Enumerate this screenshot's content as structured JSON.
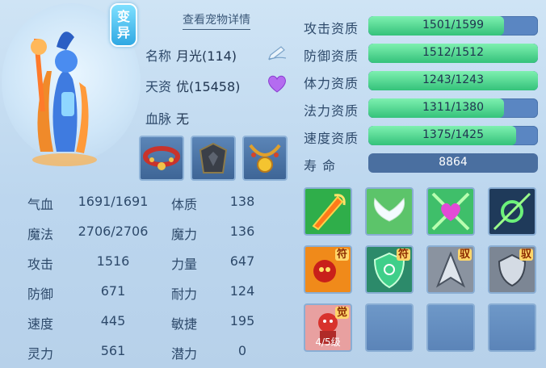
{
  "pet": {
    "variant_label": "变异",
    "detail_link": "查看宠物详情",
    "name_label": "名称",
    "name_value": "月光(114)",
    "talent_label": "天资",
    "talent_value": "优(15458)",
    "bloodline_label": "血脉",
    "bloodline_value": "无"
  },
  "equipment": [
    {
      "name": "red-collar-icon"
    },
    {
      "name": "dark-armor-icon"
    },
    {
      "name": "gold-necklace-icon"
    }
  ],
  "stats": [
    {
      "label": "气血",
      "value": "1691/1691",
      "label2": "体质",
      "value2": "138"
    },
    {
      "label": "魔法",
      "value": "2706/2706",
      "label2": "魔力",
      "value2": "136"
    },
    {
      "label": "攻击",
      "value": "1516",
      "label2": "力量",
      "value2": "647"
    },
    {
      "label": "防御",
      "value": "671",
      "label2": "耐力",
      "value2": "124"
    },
    {
      "label": "速度",
      "value": "445",
      "label2": "敏捷",
      "value2": "195"
    },
    {
      "label": "灵力",
      "value": "561",
      "label2": "潜力",
      "value2": "0"
    }
  ],
  "aptitudes": [
    {
      "label": "攻击资质",
      "text": "1501/1599",
      "fraction": 0.8
    },
    {
      "label": "防御资质",
      "text": "1512/1512",
      "fraction": 1.0
    },
    {
      "label": "体力资质",
      "text": "1243/1243",
      "fraction": 1.0
    },
    {
      "label": "法力资质",
      "text": "1311/1380",
      "fraction": 0.8
    },
    {
      "label": "速度资质",
      "text": "1375/1425",
      "fraction": 0.87
    }
  ],
  "life": {
    "label": "寿    命",
    "value": "8864"
  },
  "skills": [
    {
      "name": "flame-sword-icon",
      "tag": ""
    },
    {
      "name": "angel-wings-icon",
      "tag": ""
    },
    {
      "name": "glowing-heart-icon",
      "tag": ""
    },
    {
      "name": "green-spiral-icon",
      "tag": ""
    },
    {
      "name": "fire-demon-icon",
      "tag": "符"
    },
    {
      "name": "green-shield-icon",
      "tag": "符"
    },
    {
      "name": "silver-blade-icon",
      "tag": "驭"
    },
    {
      "name": "silver-shield-icon",
      "tag": "驭"
    },
    {
      "name": "awakened-demon-icon",
      "tag": "觉",
      "level": "4/5级"
    }
  ],
  "colors": {
    "accent_green": "#34c27a",
    "bar_bg": "#5a86c2",
    "text": "#2e4a6b"
  }
}
